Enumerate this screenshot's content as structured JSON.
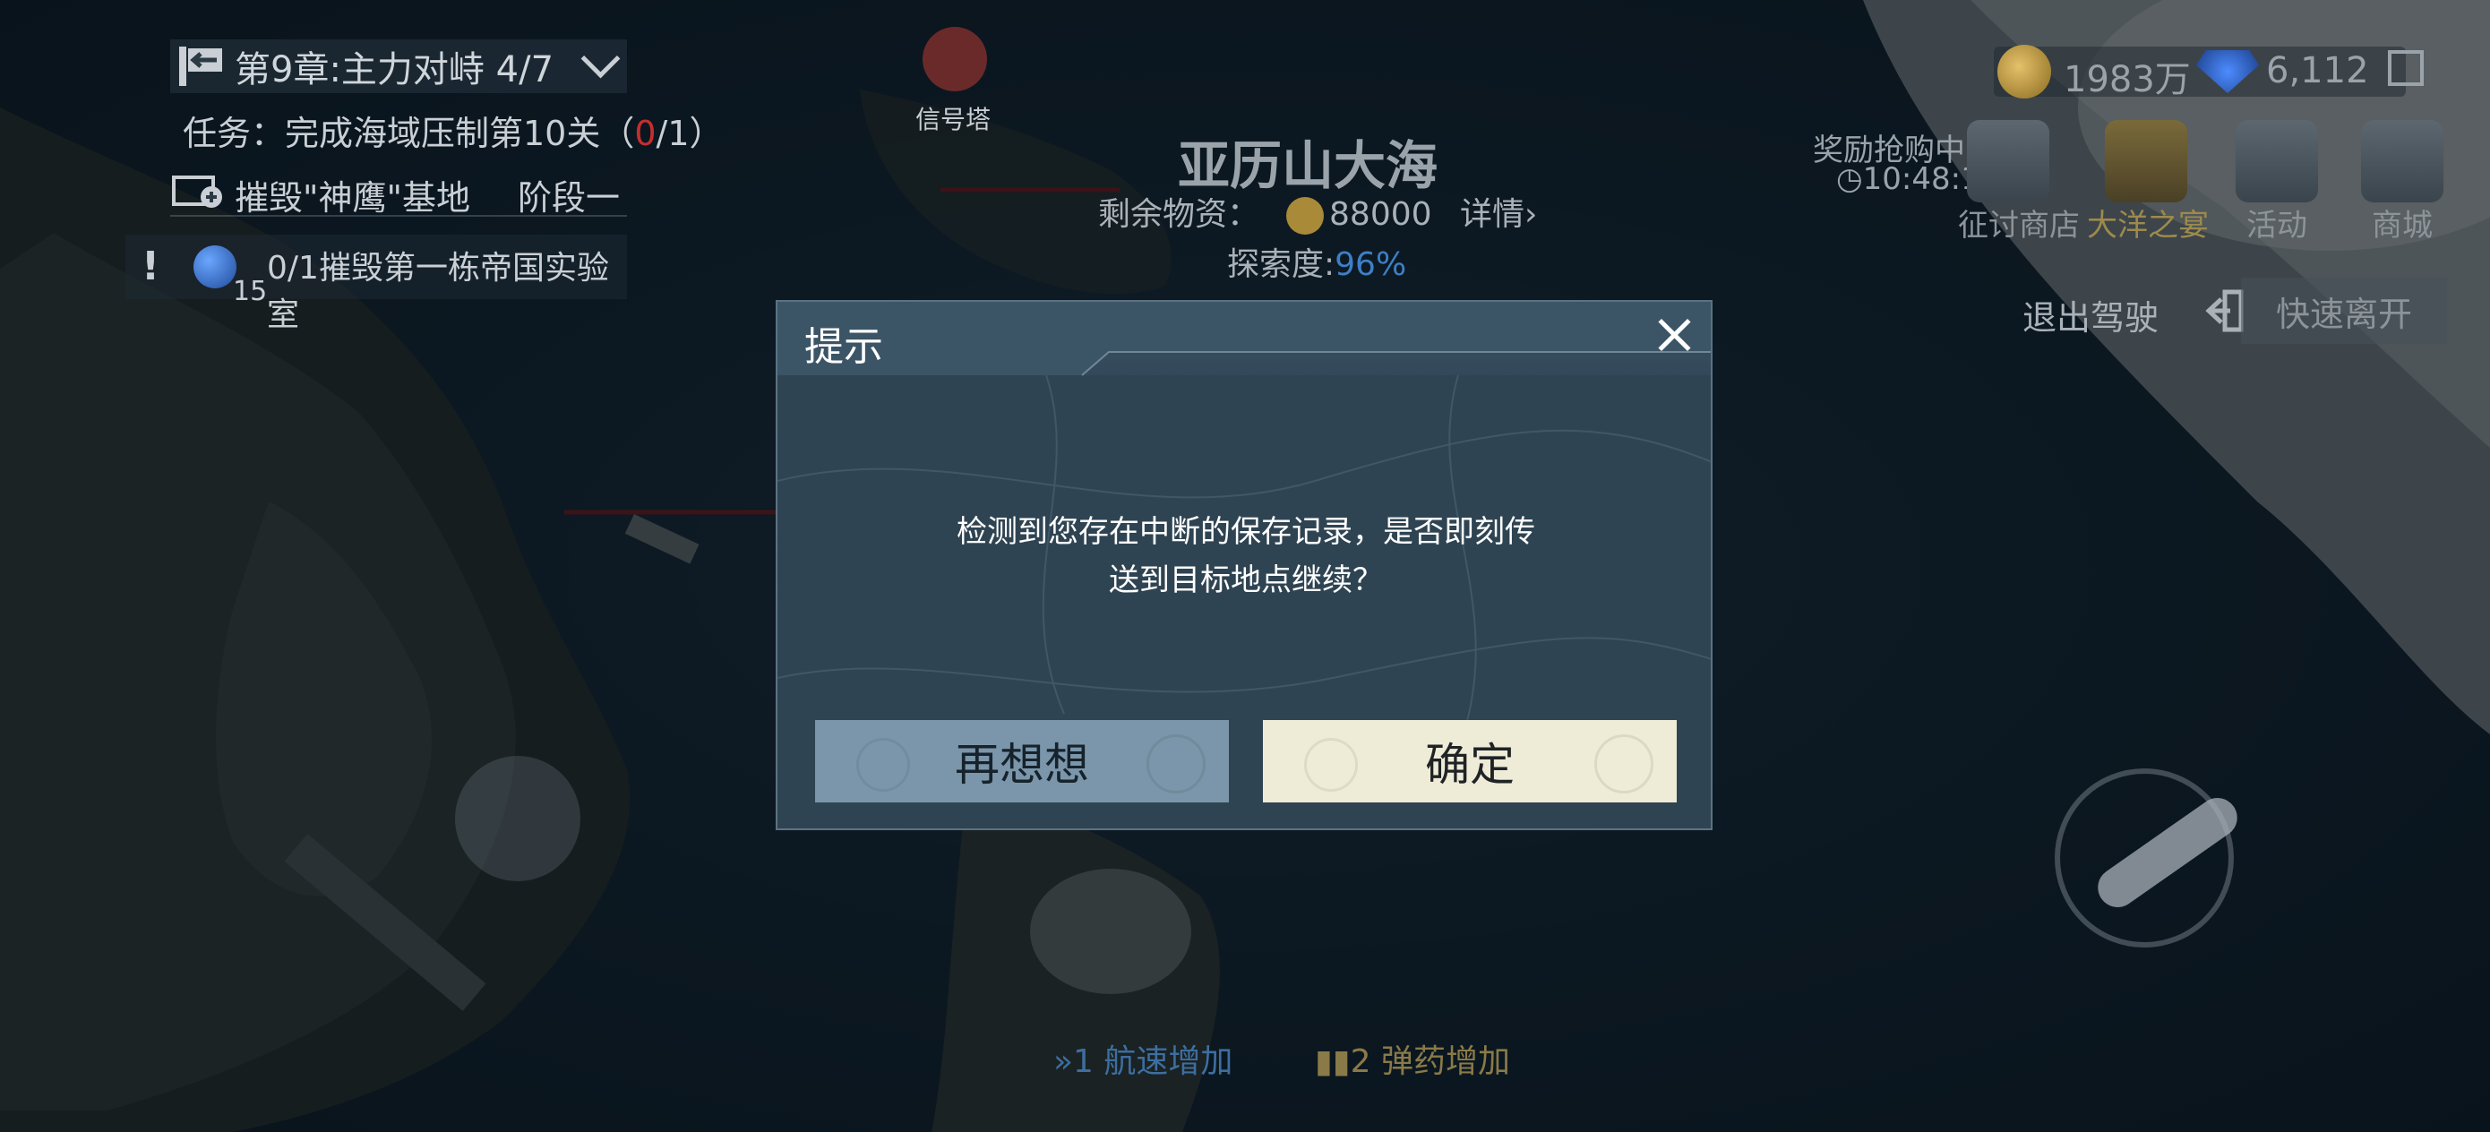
{
  "hud": {
    "chapter": "第9章:主力对峙 4/7",
    "task_prefix": "任务：完成海域压制第10关（",
    "task_progress": "0",
    "task_suffix": "/1）",
    "stage_label": "摧毁\"神鹰\"基地",
    "stage_phase": "阶段一",
    "objective_count": "15",
    "objective_text": "0/1摧毁第一栋帝国实验室",
    "signal_tower": "信号塔",
    "sea_name": "亚历山大海",
    "resources_label": "剩余物资：",
    "resources_value": "88000",
    "resources_detail": "详情",
    "explore_label": "探索度:",
    "explore_value": "96%",
    "gold": "1983万",
    "diamonds": "6,112",
    "flash_sale": "奖励抢购中",
    "timer": "10:48:17",
    "shops": [
      {
        "label": "征讨商店",
        "icon": "crusade-shop-icon"
      },
      {
        "label": "大洋之宴",
        "icon": "carnival-icon"
      },
      {
        "label": "活动",
        "icon": "activity-icon"
      },
      {
        "label": "商城",
        "icon": "mall-icon"
      }
    ],
    "exit_drive": "退出驾驶",
    "quick_leave": "快速离开",
    "buff1": "1 航速增加",
    "buff2": "2 弹药增加"
  },
  "dialog": {
    "title": "提示",
    "message_line1": "检测到您存在中断的保存记录，是否即刻传",
    "message_line2": "送到目标地点继续？",
    "cancel_label": "再想想",
    "confirm_label": "确定"
  },
  "colors": {
    "dialog_bg": "#2f4452",
    "cancel_bg": "#7b96aa",
    "confirm_bg": "#eeebd6",
    "highlight_red": "#c62e2e",
    "explore_blue": "#3d7fc6"
  }
}
